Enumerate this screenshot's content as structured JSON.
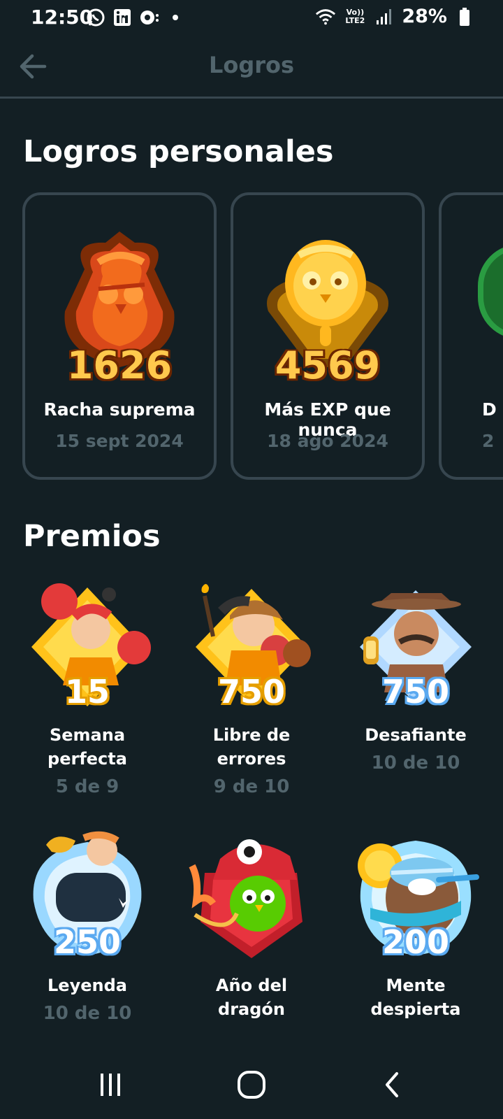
{
  "status_bar": {
    "time": "12:50",
    "network": "Vo)) LTE2",
    "battery": "28%",
    "icons": [
      "whatsapp-icon",
      "linkedin-icon",
      "chat-icon",
      "dot-icon",
      "wifi-icon",
      "signal-icon",
      "battery-icon"
    ]
  },
  "app_bar": {
    "title": "Logros",
    "back_icon": "arrow-left-icon"
  },
  "personal": {
    "title": "Logros personales",
    "cards": [
      {
        "value": "1626",
        "name": "Racha suprema",
        "date": "15 sept 2024"
      },
      {
        "value": "4569",
        "name": "Más EXP que nunca",
        "date": "18 ago 2024"
      },
      {
        "name": "D",
        "date": "2"
      }
    ]
  },
  "awards": {
    "title": "Premios",
    "items": [
      {
        "count": "15",
        "label_line1": "Semana",
        "label_line2": "perfecta",
        "progress": "5 de 9"
      },
      {
        "count": "750",
        "label_line1": "Libre de",
        "label_line2": "errores",
        "progress": "9 de 10"
      },
      {
        "count": "750",
        "label_line1": "Desafiante",
        "label_line2": "",
        "progress": "10 de 10"
      },
      {
        "count": "250",
        "label_line1": "Leyenda",
        "label_line2": "",
        "progress": "10 de 10"
      },
      {
        "count": "",
        "label_line1": "Año del",
        "label_line2": "dragón",
        "progress": ""
      },
      {
        "count": "200",
        "label_line1": "Mente",
        "label_line2": "despierta",
        "progress": ""
      }
    ]
  },
  "colors": {
    "background": "#131f24",
    "border": "#37464f",
    "muted": "#52656d"
  }
}
